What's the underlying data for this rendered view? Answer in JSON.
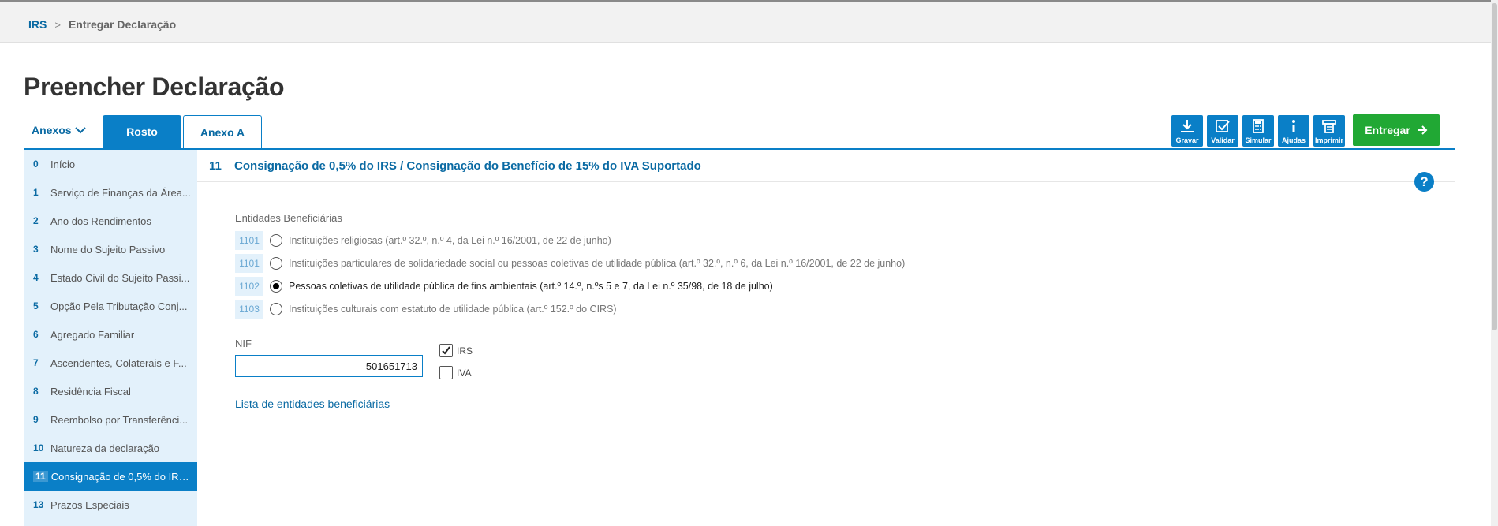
{
  "breadcrumb": {
    "root": "IRS",
    "separator": ">",
    "current": "Entregar Declaração"
  },
  "page": {
    "title": "Preencher Declaração"
  },
  "tabs": {
    "anexos": "Anexos",
    "rosto": "Rosto",
    "anexo_a": "Anexo A"
  },
  "toolbar": {
    "gravar": "Gravar",
    "validar": "Validar",
    "simular": "Simular",
    "ajudas": "Ajudas",
    "imprimir": "Imprimir",
    "entregar": "Entregar"
  },
  "sidebar": {
    "items": [
      {
        "num": "0",
        "label": "Início"
      },
      {
        "num": "1",
        "label": "Serviço de Finanças da Área..."
      },
      {
        "num": "2",
        "label": "Ano dos Rendimentos"
      },
      {
        "num": "3",
        "label": "Nome do Sujeito Passivo"
      },
      {
        "num": "4",
        "label": "Estado Civil do Sujeito Passi..."
      },
      {
        "num": "5",
        "label": "Opção Pela Tributação Conj..."
      },
      {
        "num": "6",
        "label": "Agregado Familiar"
      },
      {
        "num": "7",
        "label": "Ascendentes, Colaterais e F..."
      },
      {
        "num": "8",
        "label": "Residência Fiscal"
      },
      {
        "num": "9",
        "label": "Reembolso por Transferênci..."
      },
      {
        "num": "10",
        "label": "Natureza da declaração"
      },
      {
        "num": "11",
        "label": "Consignação de 0,5% do IRS..."
      },
      {
        "num": "13",
        "label": "Prazos Especiais"
      }
    ],
    "active_index": 11
  },
  "section": {
    "num": "11",
    "title": "Consignação de 0,5% do IRS / Consignação do Benefício de 15% do IVA Suportado",
    "help": "?"
  },
  "entities": {
    "label": "Entidades Beneficiárias",
    "options": [
      {
        "code": "1101",
        "label": "Instituições religiosas (art.º 32.º, n.º 4, da Lei n.º 16/2001, de 22 de junho)",
        "selected": false
      },
      {
        "code": "1101",
        "label": "Instituições particulares de solidariedade social ou pessoas coletivas de utilidade pública (art.º 32.º, n.º 6, da Lei n.º 16/2001, de 22 de junho)",
        "selected": false
      },
      {
        "code": "1102",
        "label": "Pessoas coletivas de utilidade pública de fins ambientais (art.º 14.º, n.ºs 5 e 7, da Lei n.º 35/98, de 18 de julho)",
        "selected": true
      },
      {
        "code": "1103",
        "label": "Instituições culturais com estatuto de utilidade pública (art.º 152.º do CIRS)",
        "selected": false
      }
    ]
  },
  "nif": {
    "label": "NIF",
    "value": "501651713",
    "irs_label": "IRS",
    "irs_checked": true,
    "iva_label": "IVA",
    "iva_checked": false
  },
  "lista_link": "Lista de entidades beneficiárias"
}
